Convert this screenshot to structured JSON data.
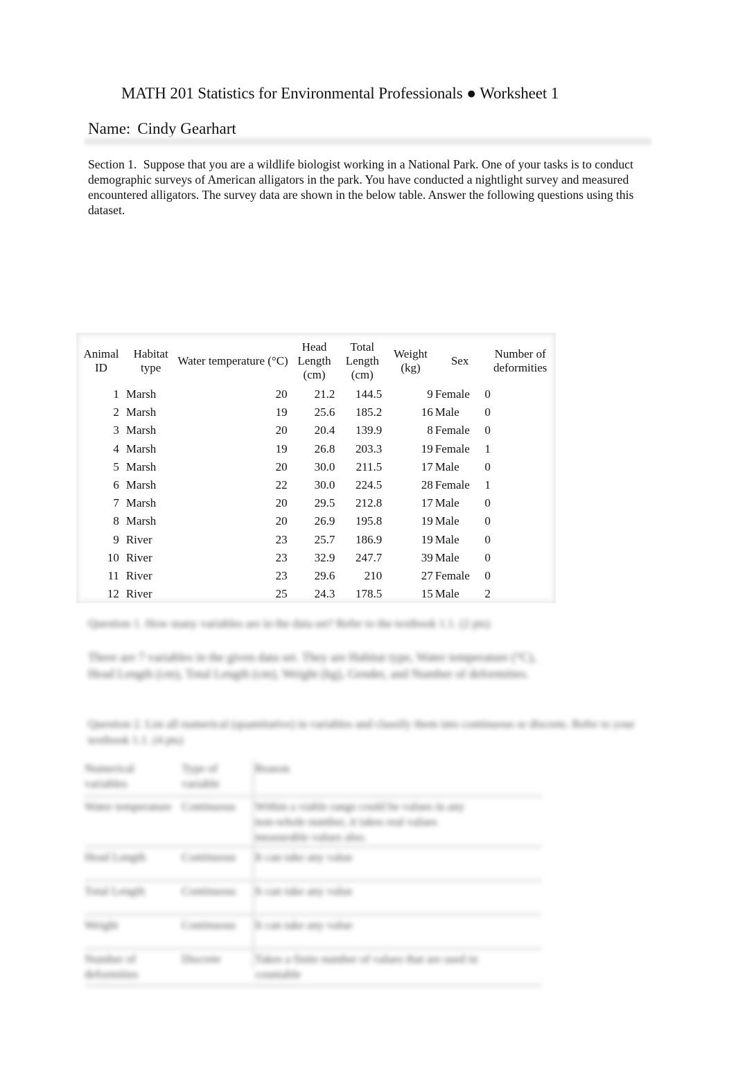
{
  "header": {
    "title": "MATH 201 Statistics for Environmental Professionals ● Worksheet 1",
    "name_label": "Name:",
    "name_value": "Cindy Gearhart"
  },
  "intro": {
    "section_label": "Section 1.",
    "text": "Suppose that you are a wildlife biologist working in a National Park. One of your tasks is to conduct demographic surveys of American alligators in the park. You have conducted a nightlight survey and measured encountered alligators. The survey data are shown in the below table. Answer the following questions using this dataset."
  },
  "survey_table": {
    "headers": [
      "Animal ID",
      "Habitat type",
      "Water temperature (°C)",
      "Head Length (cm)",
      "Total Length (cm)",
      "Weight (kg)",
      "Sex",
      "Number of deformities"
    ],
    "rows": [
      [
        "1",
        "Marsh",
        "20",
        "21.2",
        "144.5",
        "9",
        "Female",
        "0"
      ],
      [
        "2",
        "Marsh",
        "19",
        "25.6",
        "185.2",
        "16",
        "Male",
        "0"
      ],
      [
        "3",
        "Marsh",
        "20",
        "20.4",
        "139.9",
        "8",
        "Female",
        "0"
      ],
      [
        "4",
        "Marsh",
        "19",
        "26.8",
        "203.3",
        "19",
        "Female",
        "1"
      ],
      [
        "5",
        "Marsh",
        "20",
        "30.0",
        "211.5",
        "17",
        "Male",
        "0"
      ],
      [
        "6",
        "Marsh",
        "22",
        "30.0",
        "224.5",
        "28",
        "Female",
        "1"
      ],
      [
        "7",
        "Marsh",
        "20",
        "29.5",
        "212.8",
        "17",
        "Male",
        "0"
      ],
      [
        "8",
        "Marsh",
        "20",
        "26.9",
        "195.8",
        "19",
        "Male",
        "0"
      ],
      [
        "9",
        "River",
        "23",
        "25.7",
        "186.9",
        "19",
        "Male",
        "0"
      ],
      [
        "10",
        "River",
        "23",
        "32.9",
        "247.7",
        "39",
        "Male",
        "0"
      ],
      [
        "11",
        "River",
        "23",
        "29.6",
        "210",
        "27",
        "Female",
        "0"
      ],
      [
        "12",
        "River",
        "25",
        "24.3",
        "178.5",
        "15",
        "Male",
        "2"
      ]
    ]
  },
  "blurred": {
    "question1": "Question 1. How many variables are in the data set? Refer to the textbook 1.1. (2 pts)",
    "answer1": "There are 7 variables in the given data set. They are Habitat type, Water temperature (°C), Head Length (cm), Total Length (cm), Weight (kg), Gender, and Number of deformities.",
    "question2": "Question 2. List all numerical (quantitative) in variables and classify them into continuous or discrete. Refer to your textbook 1.1. (4 pts)",
    "var_rows": [
      [
        "Numerical variables",
        "Type of variable",
        "Reason"
      ],
      [
        "Water temperature",
        "Continuous",
        "Within a viable range could be values in any non-whole number, it takes real values measurable values also."
      ],
      [
        "Head Length",
        "Continuous",
        "It can take any value"
      ],
      [
        "Total Length",
        "Continuous",
        "It can take any value"
      ],
      [
        "Weight",
        "Continuous",
        "It can take any value"
      ],
      [
        "Number of deformities",
        "Discrete",
        "Takes a finite number of values that are used in countable"
      ]
    ]
  }
}
